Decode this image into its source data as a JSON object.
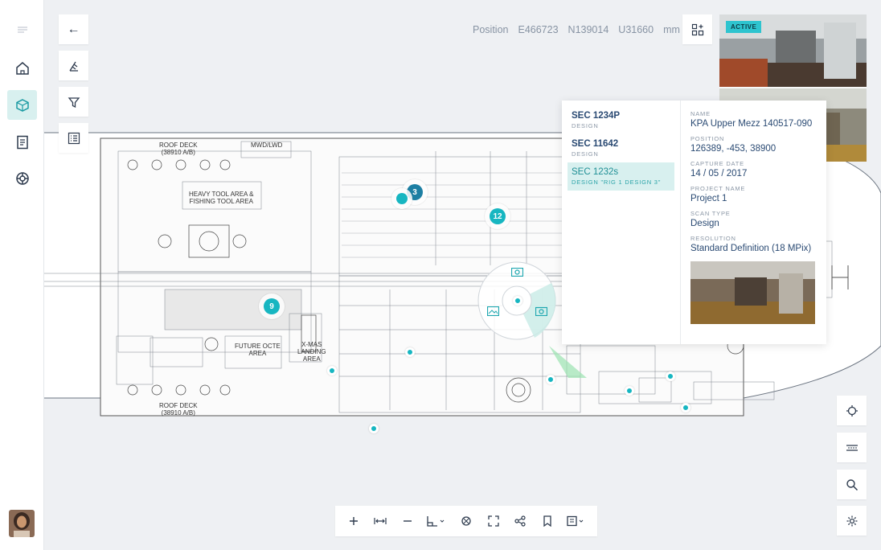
{
  "colors": {
    "accent": "#17b6c1",
    "selected_bg": "#d8f0ef",
    "text_dark": "#2a4a73",
    "text_muted": "#8a96a5"
  },
  "sidebar": {
    "items": [
      {
        "icon": "menu-icon"
      },
      {
        "icon": "home-icon"
      },
      {
        "icon": "cube-icon",
        "active": true
      },
      {
        "icon": "document-icon"
      },
      {
        "icon": "lifebuoy-icon"
      }
    ]
  },
  "toolbar_left": {
    "back_label": "←"
  },
  "position": {
    "label": "Position",
    "e": "E466723",
    "n": "N139014",
    "u": "U31660",
    "unit": "mm"
  },
  "thumbnail": {
    "badge": "ACTIVE"
  },
  "map": {
    "labels": {
      "roof_deck_top": "ROOF DECK",
      "roof_deck_top_sub": "(38910 A/B)",
      "mwd_lwd": "MWD/LWD",
      "heavy_tool": "HEAVY TOOL AREA &",
      "heavy_tool_sub": "FISHING TOOL AREA",
      "future_octe": "FUTURE OCTE",
      "future_octe_sub": "AREA",
      "xmas": "X-MAS",
      "xmas_sub": "LANDING",
      "xmas_sub2": "AREA",
      "roof_deck_bottom": "ROOF DECK",
      "roof_deck_bottom_sub": "(38910 A/B)"
    },
    "markers": [
      {
        "label": "3"
      },
      {
        "label": "12"
      },
      {
        "label": "9"
      }
    ]
  },
  "popup": {
    "scans": [
      {
        "name": "SEC 1234P",
        "type": "DESIGN",
        "selected": false
      },
      {
        "name": "SEC 11642",
        "type": "DESIGN",
        "selected": false
      },
      {
        "name": "SEC 1232s",
        "type": "DESIGN \"RIG 1 DESIGN 3\"",
        "selected": true
      }
    ],
    "details": {
      "name_label": "NAME",
      "name_value": "KPA Upper Mezz 140517-090",
      "position_label": "POSITION",
      "position_value": "126389, -453, 38900",
      "capture_label": "CAPTURE DATE",
      "capture_value": "14 / 05 / 2017",
      "project_label": "PROJECT NAME",
      "project_value": "Project 1",
      "scan_type_label": "SCAN TYPE",
      "scan_type_value": "Design",
      "resolution_label": "RESOLUTION",
      "resolution_value": "Standard Definition (18 MPix)"
    }
  }
}
